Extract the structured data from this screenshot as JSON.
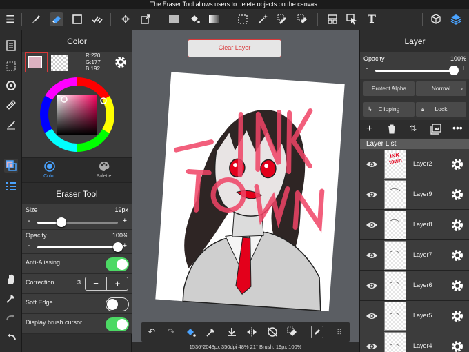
{
  "banner": {
    "text": "The Eraser Tool allows users to delete objects on the canvas."
  },
  "toolbar": {
    "icons": [
      "menu-icon",
      "brush-icon",
      "eraser-icon",
      "rect-icon",
      "check-lines-icon",
      "move-icon",
      "transform-icon",
      "fill-color-icon",
      "bucket-icon",
      "gradient-icon",
      "select-rect-icon",
      "magic-wand-icon",
      "select-pen-icon",
      "select-eraser-icon",
      "layout-icon",
      "cursor-select-icon",
      "text-icon",
      "3d-icon",
      "layers-stack-icon"
    ],
    "text_tool_label": "T"
  },
  "color_panel": {
    "title": "Color",
    "rgb": {
      "r": "R:220",
      "g": "G:177",
      "b": "B:192"
    },
    "primary_color": "#dcb1c0",
    "tabs": [
      {
        "label": "Color"
      },
      {
        "label": "Palette"
      }
    ]
  },
  "tool_panel": {
    "title": "Eraser Tool",
    "size_label": "Size",
    "size_value": "19px",
    "size_level": 0.3,
    "opacity_label": "Opacity",
    "opacity_value": "100%",
    "opacity_level": 1.0,
    "minus": "-",
    "plus": "+",
    "anti_aliasing_label": "Anti-Aliasing",
    "anti_aliasing_on": true,
    "correction_label": "Correction",
    "correction_value": "3",
    "soft_edge_label": "Soft Edge",
    "soft_edge_on": false,
    "display_cursor_label": "Display brush cursor",
    "display_cursor_on": true
  },
  "canvas": {
    "clear_layer_label": "Clear Layer",
    "status": "1536*2048px 350dpi 48% 21° Brush: 19px 100%",
    "doodle_text": "INK town"
  },
  "layer_panel": {
    "title": "Layer",
    "opacity_label": "Opacity",
    "opacity_value": "100%",
    "opacity_level": 1.0,
    "minus": "-",
    "plus": "+",
    "protect_alpha_label": "Protect Alpha",
    "blend_mode_label": "Normal",
    "clipping_label": "Clipping",
    "lock_label": "Lock",
    "layer_list_label": "Layer List",
    "layers": [
      {
        "name": "Layer2",
        "thumb_text": "INK town"
      },
      {
        "name": "Layer9"
      },
      {
        "name": "Layer8"
      },
      {
        "name": "Layer7"
      },
      {
        "name": "Layer6"
      },
      {
        "name": "Layer5"
      },
      {
        "name": "Layer4"
      }
    ]
  },
  "colors": {
    "accent_green": "#4cd964",
    "accent_red": "#d9393a",
    "accent_blue": "#4aa3ff"
  }
}
